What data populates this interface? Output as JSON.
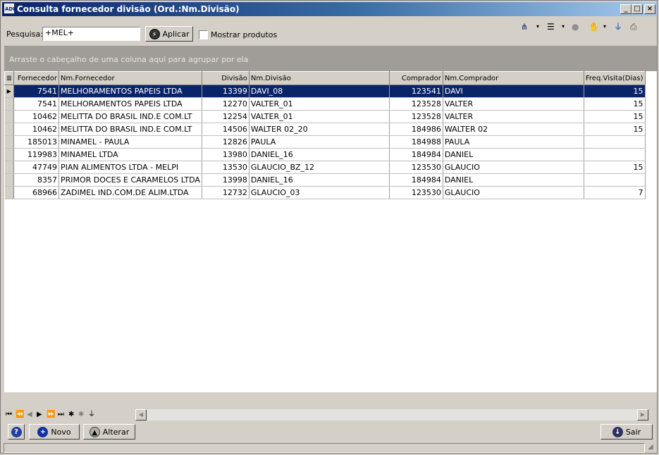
{
  "window": {
    "app_icon": "ADM",
    "title": "Consulta fornecedor divisão (Ord.:Nm.Divisão)",
    "minimize_label": "_",
    "maximize_label": "□",
    "close_label": "×"
  },
  "search": {
    "label": "Pesquisa:",
    "value": "+MEL+",
    "apply_label": "Aplicar",
    "show_products_label": "Mostrar produtos",
    "show_products_checked": false
  },
  "toolbar": {
    "icons": [
      "column-chooser-icon",
      "layout-icon",
      "record-status-icon",
      "hand-icon",
      "filter-icon",
      "print-icon"
    ]
  },
  "group_panel": {
    "hint": "Arraste o cabeçalho de uma coluna aqui para agrupar por ela"
  },
  "grid": {
    "columns": [
      "Fornecedor",
      "Nm.Fornecedor",
      "Divisão",
      "Nm.Divisão",
      "Comprador",
      "Nm.Comprador",
      "Freq.Visita(Dias)"
    ],
    "rows": [
      {
        "fornecedor": "7541",
        "nm_fornecedor": "MELHORAMENTOS PAPEIS LTDA",
        "divisao": "13399",
        "nm_divisao": "DAVI_08",
        "comprador": "123541",
        "nm_comprador": "DAVI",
        "freq": "15",
        "selected": true
      },
      {
        "fornecedor": "7541",
        "nm_fornecedor": "MELHORAMENTOS PAPEIS LTDA",
        "divisao": "12270",
        "nm_divisao": "VALTER_01",
        "comprador": "123528",
        "nm_comprador": "VALTER",
        "freq": "15"
      },
      {
        "fornecedor": "10462",
        "nm_fornecedor": "MELITTA DO BRASIL IND.E COM.LT",
        "divisao": "12254",
        "nm_divisao": "VALTER_01",
        "comprador": "123528",
        "nm_comprador": "VALTER",
        "freq": "15"
      },
      {
        "fornecedor": "10462",
        "nm_fornecedor": "MELITTA DO BRASIL IND.E COM.LT",
        "divisao": "14506",
        "nm_divisao": "WALTER 02_20",
        "comprador": "184986",
        "nm_comprador": "WALTER 02",
        "freq": "15"
      },
      {
        "fornecedor": "185013",
        "nm_fornecedor": "MINAMEL - PAULA",
        "divisao": "12826",
        "nm_divisao": "PAULA",
        "comprador": "184988",
        "nm_comprador": "PAULA",
        "freq": ""
      },
      {
        "fornecedor": "119983",
        "nm_fornecedor": "MINAMEL LTDA",
        "divisao": "13980",
        "nm_divisao": "DANIEL_16",
        "comprador": "184984",
        "nm_comprador": "DANIEL",
        "freq": ""
      },
      {
        "fornecedor": "47749",
        "nm_fornecedor": "PIAN ALIMENTOS LTDA - MELPI",
        "divisao": "13530",
        "nm_divisao": "GLAUCIO_BZ_12",
        "comprador": "123530",
        "nm_comprador": "GLAUCIO",
        "freq": "15"
      },
      {
        "fornecedor": "8357",
        "nm_fornecedor": "PRIMOR DOCES E CARAMELOS LTDA",
        "divisao": "13998",
        "nm_divisao": "DANIEL_16",
        "comprador": "184984",
        "nm_comprador": "DANIEL",
        "freq": ""
      },
      {
        "fornecedor": "68966",
        "nm_fornecedor": "ZADIMEL IND.COM.DE ALIM.LTDA",
        "divisao": "12732",
        "nm_divisao": "GLAUCIO_03",
        "comprador": "123530",
        "nm_comprador": "GLAUCIO",
        "freq": "7"
      }
    ]
  },
  "navigator": {
    "icons": [
      "first-page-icon",
      "prior-page-icon",
      "prior-icon",
      "next-icon",
      "next-page-icon",
      "last-icon",
      "insert-icon",
      "delete-icon",
      "filter-icon"
    ]
  },
  "footer": {
    "help_icon": "?",
    "new_label": "Novo",
    "edit_label": "Alterar",
    "exit_label": "Sair"
  },
  "colors": {
    "title_start": "#0a246a",
    "title_end": "#a6caf0",
    "selection": "#0a246a",
    "group_panel": "#a09c98",
    "face": "#d4d0c8"
  }
}
